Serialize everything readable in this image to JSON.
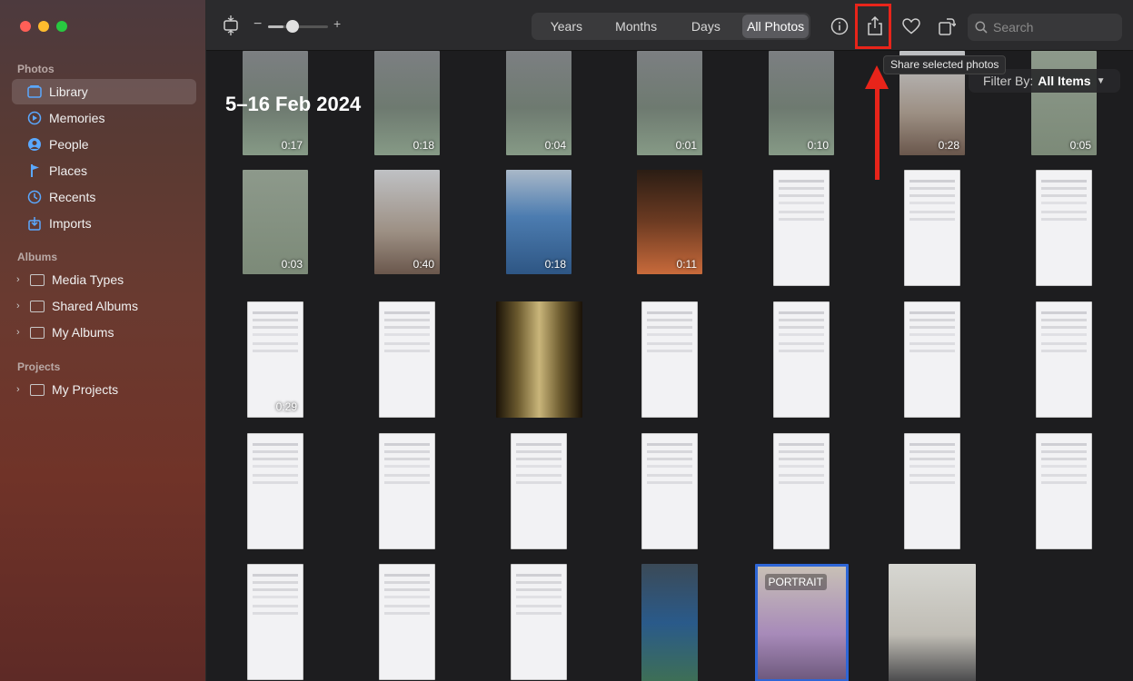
{
  "sidebar": {
    "sections": [
      {
        "heading": "Photos",
        "items": [
          {
            "label": "Library",
            "icon": "library-icon",
            "active": true
          },
          {
            "label": "Memories",
            "icon": "memories-icon"
          },
          {
            "label": "People",
            "icon": "people-icon"
          },
          {
            "label": "Places",
            "icon": "places-icon"
          },
          {
            "label": "Recents",
            "icon": "recents-icon"
          },
          {
            "label": "Imports",
            "icon": "imports-icon"
          }
        ]
      },
      {
        "heading": "Albums",
        "items": [
          {
            "label": "Media Types",
            "icon": "folder-icon"
          },
          {
            "label": "Shared Albums",
            "icon": "shared-albums-icon"
          },
          {
            "label": "My Albums",
            "icon": "folder-icon"
          }
        ]
      },
      {
        "heading": "Projects",
        "items": [
          {
            "label": "My Projects",
            "icon": "folder-icon"
          }
        ]
      }
    ]
  },
  "toolbar": {
    "zoom_minus": "−",
    "zoom_plus": "+",
    "zoom_level": 0.25,
    "views": [
      "Years",
      "Months",
      "Days",
      "All Photos"
    ],
    "active_view": "All Photos",
    "search_placeholder": "Search"
  },
  "tooltip": "Share selected photos",
  "content": {
    "date_title": "5–16 Feb 2024",
    "filter_label": "Filter By:",
    "filter_value": "All Items"
  },
  "grid": [
    [
      {
        "kind": "video-desk",
        "dur": "0:17"
      },
      {
        "kind": "video-desk",
        "dur": "0:18"
      },
      {
        "kind": "video-desk",
        "dur": "0:04"
      },
      {
        "kind": "video-desk",
        "dur": "0:01"
      },
      {
        "kind": "video-desk",
        "dur": "0:10"
      },
      {
        "kind": "hand",
        "dur": "0:28"
      },
      {
        "kind": "green",
        "dur": "0:05"
      }
    ],
    [
      {
        "kind": "green",
        "dur": "0:03"
      },
      {
        "kind": "hand",
        "dur": "0:40"
      },
      {
        "kind": "blue",
        "dur": "0:18"
      },
      {
        "kind": "dark",
        "dur": "0:11"
      },
      {
        "kind": "screen",
        "dur": ""
      },
      {
        "kind": "screen",
        "dur": ""
      },
      {
        "kind": "screen",
        "dur": ""
      }
    ],
    [
      {
        "kind": "screen",
        "dur": "0:29"
      },
      {
        "kind": "screen",
        "dur": ""
      },
      {
        "kind": "port",
        "dur": ""
      },
      {
        "kind": "screen",
        "dur": ""
      },
      {
        "kind": "screen",
        "dur": ""
      },
      {
        "kind": "screen",
        "dur": ""
      },
      {
        "kind": "screen",
        "dur": ""
      }
    ],
    [
      {
        "kind": "screen",
        "dur": ""
      },
      {
        "kind": "screen",
        "dur": ""
      },
      {
        "kind": "screen",
        "dur": ""
      },
      {
        "kind": "screen",
        "dur": ""
      },
      {
        "kind": "screen",
        "dur": ""
      },
      {
        "kind": "screen",
        "dur": ""
      },
      {
        "kind": "screen",
        "dur": ""
      }
    ],
    [
      {
        "kind": "screen",
        "dur": ""
      },
      {
        "kind": "screen",
        "dur": ""
      },
      {
        "kind": "screen",
        "dur": ""
      },
      {
        "kind": "lock",
        "dur": ""
      },
      {
        "kind": "portrait",
        "dur": "",
        "label": "PORTRAIT"
      },
      {
        "kind": "office",
        "dur": ""
      }
    ]
  ],
  "colors": {
    "highlight": "#e8241a",
    "accent": "#5aa8ff",
    "selection": "#2e66d6"
  }
}
